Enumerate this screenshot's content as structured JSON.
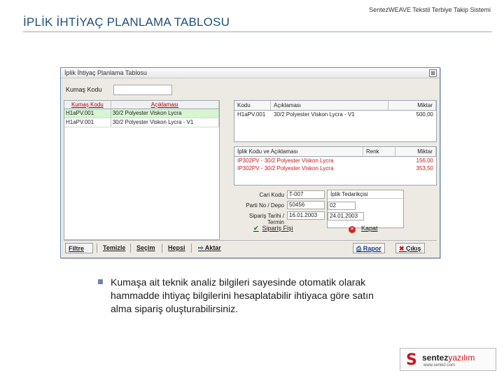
{
  "slide": {
    "title": "İPLİK İHTİYAÇ PLANLAMA TABLOSU",
    "header_right": "SentezWEAVE Tekstil Terbiye Takip Sistemi",
    "bullet_text": "Kumaşa ait teknik analiz bilgileri sayesinde otomatik olarak hammadde ihtiyaç bilgilerini hesaplatabilir ihtiyaca göre satın alma sipariş oluşturabilirsiniz."
  },
  "window": {
    "title": "İplik İhtiyaç Planlama Tablosu",
    "close_glyph": "⊠",
    "fabric_code_label": "Kumaş Kodu",
    "fabric_code_value": ""
  },
  "left_grid": {
    "headers": [
      "Kumaş Kodu",
      "Açıklaması"
    ],
    "rows": [
      [
        "H1aPV.001",
        "30/2 Polyester Viskon Lycra"
      ],
      [
        "H1aPV.001",
        "30/2 Polyester Viskon Lycra - V1"
      ]
    ]
  },
  "top_grid": {
    "headers": [
      "Kodu",
      "Açıklaması",
      "Miktar"
    ],
    "rows": [
      [
        "H1aPV.001",
        "30/2 Polyester Viskon Lycra - V1",
        "500,00"
      ]
    ]
  },
  "yarn_grid": {
    "headers": [
      "İplik Kodu ve Açıklaması",
      "Renk",
      "Miktar"
    ],
    "rows": [
      [
        "IP302PV - 30/2 Polyester Viskon Lycra",
        "",
        "156,00"
      ],
      [
        "IP302PV - 30/2 Polyester Viskon Lycra",
        "",
        "353,50"
      ]
    ]
  },
  "detail": {
    "fields": [
      {
        "label": "Cari Kodu",
        "value": "T-007"
      },
      {
        "label": "Parti No / Depo",
        "value": "50456"
      },
      {
        "label": "Sipariş Tarihi / Termin",
        "value": "16.01.2003"
      }
    ],
    "depo_value": "02",
    "termin_value": "24.01.2003",
    "side_title": "İplik Tedarikçisi",
    "order_button": "Sipariş Fişi",
    "cancel_button": "Kapat"
  },
  "toolbar": {
    "filter": "Filtre",
    "clear": "Temizle",
    "select": "Seçim",
    "all": "Hepsi",
    "export": "Aktar",
    "report": "Rapor",
    "exit": "Çıkış"
  },
  "logo": {
    "mark": "S",
    "name_bold": "sentez",
    "name_light": "yazılım",
    "sub": "www.sentez.com"
  }
}
